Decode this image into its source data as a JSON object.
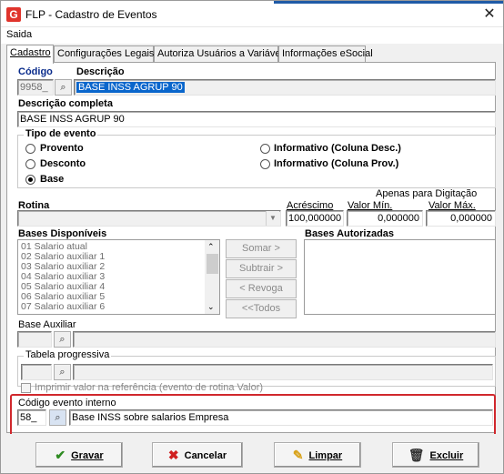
{
  "window": {
    "title": "FLP - Cadastro de Eventos",
    "app_icon": "G",
    "close_glyph": "✕"
  },
  "menu": {
    "saida": "Saida"
  },
  "tabs": [
    {
      "label": "Cadastro",
      "active": true
    },
    {
      "label": "Configurações Legais",
      "active": false
    },
    {
      "label": "Autoriza Usuários a Variáveis",
      "active": false
    },
    {
      "label": "Informações eSocial",
      "active": false
    }
  ],
  "form": {
    "codigo_label": "Código",
    "codigo_value": "9958_",
    "descricao_label": "Descrição",
    "descricao_value": "BASE INSS AGRUP  90",
    "descricao_completa_label": "Descrição completa",
    "descricao_completa_value": "BASE INSS AGRUP  90",
    "tipo_evento": {
      "title": "Tipo de evento",
      "options": [
        "Provento",
        "Desconto",
        "Base",
        "Informativo (Coluna Desc.)",
        "Informativo (Coluna Prov.)"
      ],
      "selected": "Base"
    },
    "rotina_label": "Rotina",
    "rotina_value": "",
    "apenas_digitacao_label": "Apenas para Digitação",
    "acrescimo_label": "Acréscimo",
    "acrescimo_value": "100,000000",
    "valor_min_label": "Valor Mín.",
    "valor_min_value": "0,000000",
    "valor_max_label": "Valor Máx.",
    "valor_max_value": "0,000000",
    "bases_disponiveis_label": "Bases Disponíveis",
    "bases_disponiveis": [
      "01 Salario atual",
      "02 Salario auxiliar 1",
      "03 Salario auxiliar 2",
      "04 Salario auxiliar 3",
      "05 Salario auxiliar 4",
      "06 Salario auxiliar 5",
      "07 Salario auxiliar 6"
    ],
    "bases_autorizadas_label": "Bases Autorizadas",
    "btn_somar": "Somar >",
    "btn_subtrair": "Subtrair >",
    "btn_revoga": "< Revoga",
    "btn_todos": "<<Todos",
    "base_auxiliar_label": "Base Auxiliar",
    "tabela_progressiva_label": "Tabela progressiva",
    "imprimir_label": "Imprimir valor na referência (evento de rotina Valor)",
    "codigo_evento_interno_label": "Código evento interno",
    "codigo_evento_interno_value": "58_",
    "codigo_evento_interno_desc": "Base INSS sobre salarios Empresa"
  },
  "buttons": {
    "gravar": "Gravar",
    "cancelar": "Cancelar",
    "limpar": "Limpar",
    "excluir": "Excluir"
  },
  "colors": {
    "highlight": "#d0282d",
    "selection": "#0a66cc",
    "label_blue": "#0a2c8c"
  }
}
